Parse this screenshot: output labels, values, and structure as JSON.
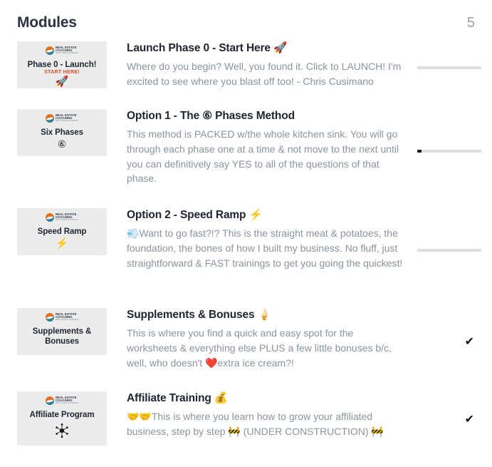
{
  "header": {
    "title": "Modules",
    "count": "5"
  },
  "brand": {
    "line1": "REAL ESTATE",
    "line2": "COACHING",
    "line3": "WITH CHRIS CUSIMANO"
  },
  "colors": {
    "title_text": "#1e2430",
    "body_text": "#8c939d",
    "count_text": "#9aa1ac",
    "thumb_bg": "#ececec",
    "progress_track": "#dedede",
    "progress_fill": "#1b1b1b",
    "check": "#111111",
    "brand_orange": "#e4701e",
    "brand_teal": "#2e6f83",
    "start_here_red": "#e04a22"
  },
  "modules": [
    {
      "thumb": {
        "title": "Phase 0 - Launch!",
        "subtitle": "START HERE!",
        "glyph": "🚀",
        "glyph_name": "rocket-icon"
      },
      "title": "Launch Phase 0 - Start Here",
      "title_emoji": "🚀",
      "title_emoji_name": "rocket-icon",
      "description": "Where do you begin? Well, you found it. Click to LAUNCH! I'm excited to see where you blast off too! - Chris Cusimano",
      "status_type": "progress",
      "progress_percent": 0
    },
    {
      "thumb": {
        "title": "Six Phases",
        "subtitle": "",
        "glyph": "⑥",
        "glyph_name": "circled-six-icon"
      },
      "title": "Option 1 - The ⑥ Phases Method",
      "title_emoji": "",
      "title_emoji_name": "",
      "description": "This method is PACKED w/the whole kitchen sink. You will go through each phase one at a time & not move to the next until you can definitively say YES to all of the questions of that phase.",
      "status_type": "progress",
      "progress_percent": 7
    },
    {
      "thumb": {
        "title": "Speed Ramp",
        "subtitle": "",
        "glyph": "⚡",
        "glyph_name": "lightning-bolt-icon"
      },
      "title": "Option 2 - Speed Ramp",
      "title_emoji": "⚡",
      "title_emoji_name": "high-voltage-icon",
      "description": "💨Want to go fast?!? This is the straight meat & potatoes, the foundation, the bones of how I built my business. No fluff, just straightforward & FAST trainings to get you going the quickest!",
      "status_type": "progress",
      "progress_percent": 0
    },
    {
      "thumb": {
        "title": "Supplements & Bonuses",
        "subtitle": "",
        "glyph": "",
        "glyph_name": ""
      },
      "title": "Supplements & Bonuses",
      "title_emoji": "🍦",
      "title_emoji_name": "soft-ice-cream-icon",
      "description": "This is where you find a quick and easy spot for the worksheets & everything else PLUS a few little bonuses b/c, well, who doesn't ❤️extra ice cream?!",
      "status_type": "check",
      "check_glyph": "✔"
    },
    {
      "thumb": {
        "title": "Affiliate Program",
        "subtitle": "",
        "glyph": "network-hub",
        "glyph_name": "network-hub-icon"
      },
      "title": "Affiliate Training",
      "title_emoji": "💰",
      "title_emoji_name": "money-bag-icon",
      "description": "🤝🤝This is where you learn how to grow your affiliated business, step by step 🚧 (UNDER CONSTRUCTION) 🚧",
      "status_type": "check",
      "check_glyph": "✔"
    }
  ]
}
